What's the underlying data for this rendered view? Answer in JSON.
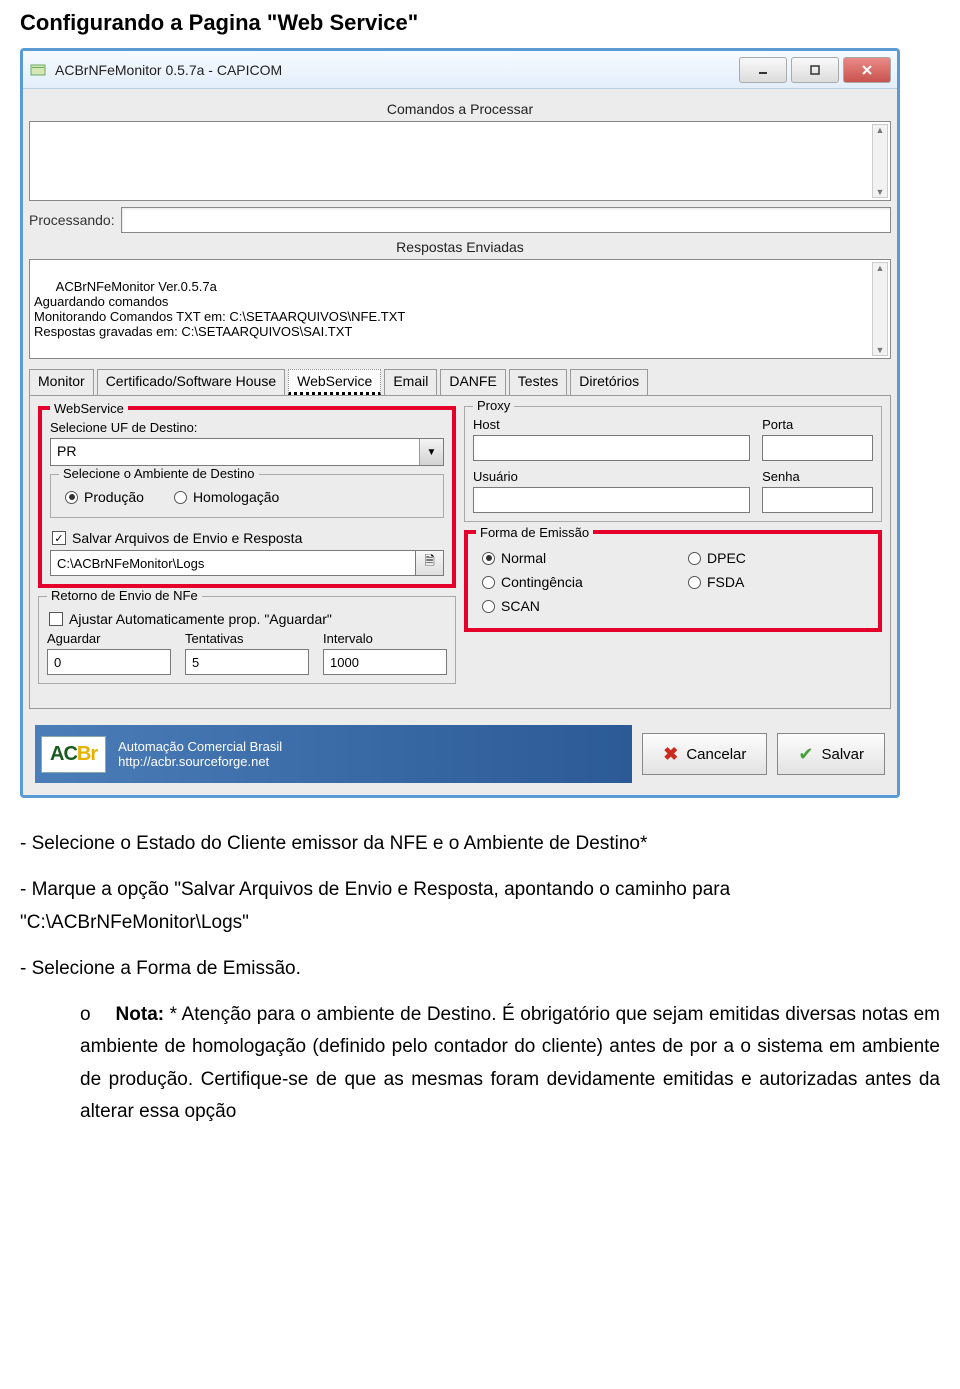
{
  "doc": {
    "page_title_quoted": "Configurando a Pagina \"Web Service\"",
    "bullet1": "- Selecione o Estado do Cliente emissor da NFE e o Ambiente de Destino*",
    "bullet2": "- Marque a opção \"Salvar Arquivos de Envio e Resposta, apontando o caminho para \"C:\\ACBrNFeMonitor\\Logs\"",
    "bullet3": "- Selecione a Forma de Emissão.",
    "note_marker": "o",
    "note_label": "Nota:",
    "note_text": " * Atenção para o ambiente de Destino. É obrigatório que sejam emitidas diversas notas em ambiente de homologação (definido pelo contador do cliente) antes de por a o sistema em ambiente de produção. Certifique-se de que as mesmas foram devidamente emitidas e autorizadas antes da alterar essa opção"
  },
  "window": {
    "title": "ACBrNFeMonitor 0.5.7a - CAPICOM",
    "section_comandos": "Comandos a Processar",
    "processando_label": "Processando:",
    "section_respostas": "Respostas Enviadas",
    "respostas_text": "ACBrNFeMonitor Ver.0.5.7a\nAguardando comandos\nMonitorando Comandos TXT em: C:\\SETAARQUIVOS\\NFE.TXT\nRespostas gravadas em: C:\\SETAARQUIVOS\\SAI.TXT",
    "tabs": [
      "Monitor",
      "Certificado/Software House",
      "WebService",
      "Email",
      "DANFE",
      "Testes",
      "Diretórios"
    ],
    "active_tab_index": 2
  },
  "webservice": {
    "legend": "WebService",
    "uf_label": "Selecione UF de Destino:",
    "uf_value": "PR",
    "ambiente_legend": "Selecione o Ambiente de Destino",
    "ambiente_options": [
      "Produção",
      "Homologação"
    ],
    "ambiente_selected": 0,
    "salvar_checkbox": "Salvar Arquivos de Envio e Resposta",
    "salvar_checked": true,
    "path_value": "C:\\ACBrNFeMonitor\\Logs"
  },
  "retorno": {
    "legend": "Retorno de Envio de NFe",
    "ajustar_checkbox": "Ajustar Automaticamente prop. \"Aguardar\"",
    "ajustar_checked": false,
    "aguardar_label": "Aguardar",
    "aguardar_value": "0",
    "tentativas_label": "Tentativas",
    "tentativas_value": "5",
    "intervalo_label": "Intervalo",
    "intervalo_value": "1000"
  },
  "proxy": {
    "legend": "Proxy",
    "host_label": "Host",
    "porta_label": "Porta",
    "usuario_label": "Usuário",
    "senha_label": "Senha",
    "host_value": "",
    "porta_value": "",
    "usuario_value": "",
    "senha_value": ""
  },
  "emissao": {
    "legend": "Forma de Emissão",
    "options": [
      "Normal",
      "DPEC",
      "Contingência",
      "FSDA",
      "SCAN"
    ],
    "selected": 0
  },
  "footer": {
    "logo_text_ac": "AC",
    "logo_text_br": "Br",
    "tagline": "Automação Comercial Brasil",
    "url": "http://acbr.sourceforge.net",
    "cancel": "Cancelar",
    "save": "Salvar"
  }
}
